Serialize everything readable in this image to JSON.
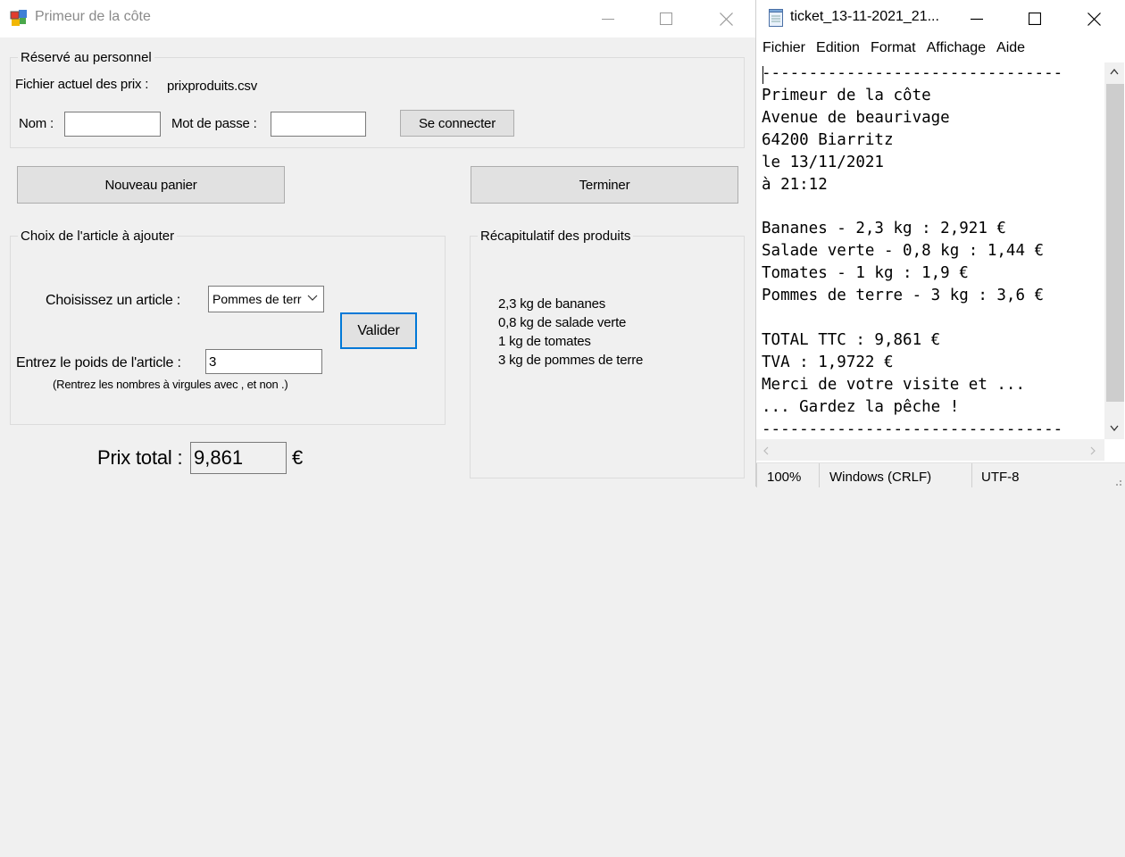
{
  "app": {
    "title": "Primeur de la côte",
    "staff_group": {
      "legend": "Réservé au personnel",
      "price_file_label": "Fichier actuel des prix :",
      "price_file_value": "prixproduits.csv",
      "name_label": "Nom :",
      "name_value": "",
      "password_label": "Mot de passe :",
      "password_value": "",
      "connect_button": "Se connecter"
    },
    "new_basket_button": "Nouveau panier",
    "finish_button": "Terminer",
    "article_group": {
      "legend": "Choix de l'article à ajouter",
      "choose_label": "Choisissez un article :",
      "selected_article": "Pommes de terre",
      "validate_button": "Valider",
      "weight_label": "Entrez le poids de l'article :",
      "weight_value": "3",
      "hint": "(Rentrez les nombres à virgules avec , et non .)"
    },
    "summary_group": {
      "legend": "Récapitulatif des produits",
      "lines": [
        "2,3 kg de bananes",
        "0,8 kg de salade verte",
        "1 kg de tomates",
        "3 kg de pommes de terre"
      ]
    },
    "total_label": "Prix total :",
    "total_value": "9,861",
    "currency": "€"
  },
  "notepad": {
    "title": "ticket_13-11-2021_21...",
    "menu": [
      "Fichier",
      "Edition",
      "Format",
      "Affichage",
      "Aide"
    ],
    "content": "--------------------------------\nPrimeur de la côte\nAvenue de beaurivage\n64200 Biarritz\nle 13/11/2021\nà 21:12\n\nBananes - 2,3 kg : 2,921 €\nSalade verte - 0,8 kg : 1,44 €\nTomates - 1 kg : 1,9 €\nPommes de terre - 3 kg : 3,6 €\n\nTOTAL TTC : 9,861 €\nTVA : 1,9722 €\nMerci de votre visite et ...\n... Gardez la pêche !\n--------------------------------",
    "status": {
      "zoom": "100%",
      "line_ending": "Windows (CRLF)",
      "encoding": "UTF-8"
    }
  },
  "colors": {
    "form_background": "#f0f0f0",
    "button_background": "#e1e1e1",
    "focus_border": "#0078d7",
    "title_inactive_text": "#8a8a8a"
  },
  "icons": {
    "app": "winforms-app-icon",
    "notepad": "notepad-icon",
    "minimize": "minimize-icon",
    "maximize": "maximize-icon",
    "close": "close-icon",
    "dropdown": "chevron-down-icon"
  }
}
